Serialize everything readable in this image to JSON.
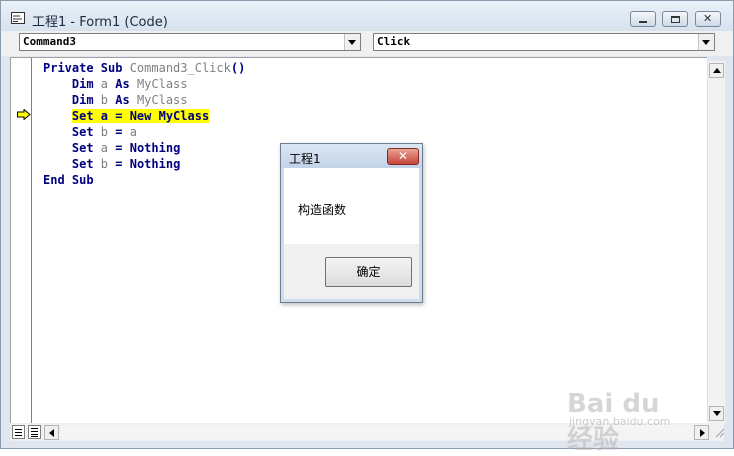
{
  "window": {
    "title": "工程1 - Form1 (Code)"
  },
  "dropdowns": {
    "object": "Command3",
    "procedure": "Click"
  },
  "code": {
    "lines": [
      {
        "parts": [
          {
            "t": "Private Sub ",
            "c": "kw"
          },
          {
            "t": "Command3_Click",
            "c": "id"
          },
          {
            "t": "()",
            "c": "kw"
          }
        ]
      },
      {
        "parts": [
          {
            "t": "    Dim ",
            "c": "kw"
          },
          {
            "t": "a",
            "c": "id"
          },
          {
            "t": " As ",
            "c": "kw"
          },
          {
            "t": "MyClass",
            "c": "id"
          }
        ]
      },
      {
        "parts": [
          {
            "t": "    Dim ",
            "c": "kw"
          },
          {
            "t": "b",
            "c": "id"
          },
          {
            "t": " As ",
            "c": "kw"
          },
          {
            "t": "MyClass",
            "c": "id"
          }
        ]
      },
      {
        "parts": [
          {
            "t": "    "
          },
          {
            "t": "Set a = New MyClass",
            "c": "hl"
          }
        ]
      },
      {
        "parts": [
          {
            "t": "    Set ",
            "c": "kw"
          },
          {
            "t": "b",
            "c": "id"
          },
          {
            "t": " = ",
            "c": "kw"
          },
          {
            "t": "a",
            "c": "id"
          }
        ]
      },
      {
        "parts": [
          {
            "t": "    Set ",
            "c": "kw"
          },
          {
            "t": "a",
            "c": "id"
          },
          {
            "t": " = ",
            "c": "kw"
          },
          {
            "t": "Nothing",
            "c": "kw"
          }
        ]
      },
      {
        "parts": [
          {
            "t": "    Set ",
            "c": "kw"
          },
          {
            "t": "b",
            "c": "id"
          },
          {
            "t": " = ",
            "c": "kw"
          },
          {
            "t": "Nothing",
            "c": "kw"
          }
        ]
      },
      {
        "parts": [
          {
            "t": "End Sub",
            "c": "kw"
          }
        ]
      }
    ],
    "current_line": 4
  },
  "msgbox": {
    "title": "工程1",
    "message": "构造函数",
    "ok_label": "确定"
  },
  "watermark": {
    "text": "Bai du 经验",
    "sub": "jingyan.baidu.com"
  },
  "colors": {
    "keyword": "#000080",
    "identifier": "#808080",
    "highlight": "#ffff00"
  }
}
